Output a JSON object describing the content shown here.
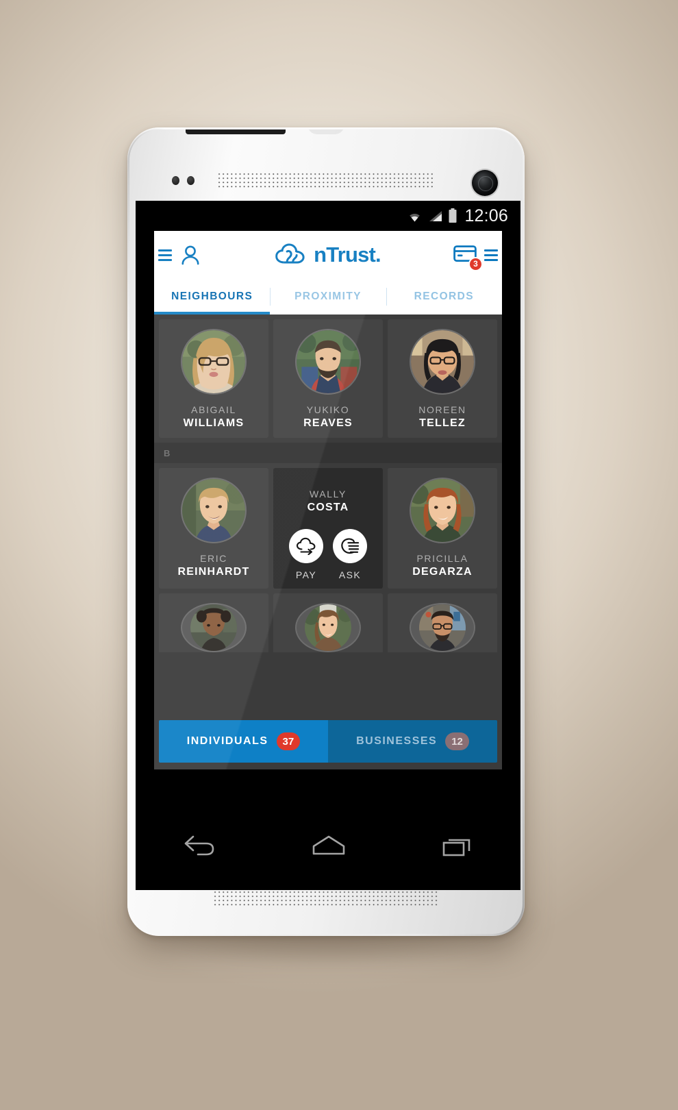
{
  "statusbar": {
    "time": "12:06",
    "icons": [
      "wifi-icon",
      "signal-icon",
      "battery-icon"
    ]
  },
  "header": {
    "menu_icon": "hamburger-menu-icon",
    "profile_icon": "person-icon",
    "logo_text": "nTrust.",
    "logo_icon": "ntrust-cloud-logo",
    "wallet_icon": "credit-card-icon",
    "wallet_badge": "3",
    "right_menu_icon": "hamburger-menu-icon",
    "accent_color": "#0b79bf",
    "badge_color": "#e0392b"
  },
  "tabs": [
    {
      "label": "NEIGHBOURS",
      "active": true
    },
    {
      "label": "PROXIMITY",
      "active": false
    },
    {
      "label": "RECORDS",
      "active": false
    }
  ],
  "contacts": {
    "rows": [
      {
        "cards": [
          {
            "first": "ABIGAIL",
            "last": "WILLIAMS",
            "avatar": "woman-glasses-blonde"
          },
          {
            "first": "YUKIKO",
            "last": "REAVES",
            "avatar": "man-plaid-shirt"
          },
          {
            "first": "NOREEN",
            "last": "TELLEZ",
            "avatar": "woman-glasses-dark-hair"
          }
        ]
      }
    ],
    "section_letter": "B",
    "row2": [
      {
        "first": "ERIC",
        "last": "REINHARDT",
        "avatar": "man-curly-blonde",
        "expanded": false
      },
      {
        "first": "WALLY",
        "last": "COSTA",
        "avatar": "",
        "expanded": true
      },
      {
        "first": "PRICILLA",
        "last": "DEGARZA",
        "avatar": "woman-red-hair",
        "expanded": false
      }
    ],
    "row3": [
      {
        "avatar": "man-afro"
      },
      {
        "avatar": "woman-brown-hair"
      },
      {
        "avatar": "man-glasses-beard"
      }
    ]
  },
  "expanded_actions": [
    {
      "label": "PAY",
      "icon": "cloud-arrow-icon"
    },
    {
      "label": "ASK",
      "icon": "hand-icon"
    }
  ],
  "filterbar": [
    {
      "label": "INDIVIDUALS",
      "count": "37",
      "active": true
    },
    {
      "label": "BUSINESSES",
      "count": "12",
      "active": false
    }
  ],
  "navbar": [
    {
      "icon": "back-icon"
    },
    {
      "icon": "home-icon"
    },
    {
      "icon": "recents-icon"
    }
  ]
}
